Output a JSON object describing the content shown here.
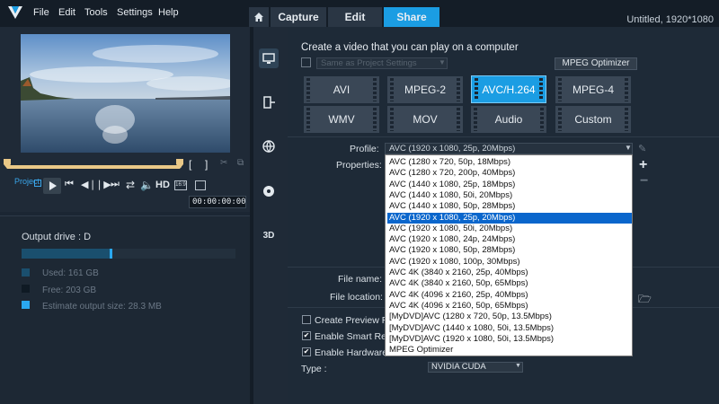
{
  "menu": {
    "items": [
      "File",
      "Edit",
      "Tools",
      "Settings",
      "Help"
    ]
  },
  "tabs": {
    "home_icon": "home-icon",
    "items": [
      "Capture",
      "Edit",
      "Share"
    ],
    "active": "Share"
  },
  "window": {
    "title": "Untitled, 1920*1080"
  },
  "player": {
    "project_label": "Project",
    "hd_label": "HD",
    "timecode": "00:00:00:00",
    "ratio_label": "16:9"
  },
  "output": {
    "drive_label": "Output drive : D",
    "used": "Used:  161 GB",
    "free": "Free:  203 GB",
    "estimate": "Estimate output size:  28.3 MB",
    "used_fraction": 0.41,
    "colors": {
      "used": "#1a4f6e",
      "free": "#0f1a24",
      "estimate": "#2aa8f0"
    }
  },
  "sidebar_icons": [
    "computer-icon",
    "device-icon",
    "web-icon",
    "disc-icon",
    "3d-icon"
  ],
  "share": {
    "heading": "Create a video that you can play on a computer",
    "same_as_project": "Same as Project Settings",
    "mpeg_optimizer_button": "MPEG Optimizer",
    "formats": [
      "AVI",
      "MPEG-2",
      "AVC/H.264",
      "MPEG-4",
      "WMV",
      "MOV",
      "Audio",
      "Custom"
    ],
    "active_format": "AVC/H.264",
    "profile_label": "Profile:",
    "profile_value": "AVC (1920 x 1080, 25p, 20Mbps)",
    "properties_label": "Properties:",
    "profile_options": [
      "AVC (1280 x 720, 50p, 18Mbps)",
      "AVC (1280 x 720, 200p, 40Mbps)",
      "AVC (1440 x 1080, 25p, 18Mbps)",
      "AVC (1440 x 1080, 50i, 20Mbps)",
      "AVC (1440 x 1080, 50p, 28Mbps)",
      "AVC (1920 x 1080, 25p, 20Mbps)",
      "AVC (1920 x 1080, 50i, 20Mbps)",
      "AVC (1920 x 1080, 24p, 24Mbps)",
      "AVC (1920 x 1080, 50p, 28Mbps)",
      "AVC (1920 x 1080, 100p, 30Mbps)",
      "AVC 4K (3840 x 2160, 25p, 40Mbps)",
      "AVC 4K (3840 x 2160, 50p, 65Mbps)",
      "AVC 4K (4096 x 2160, 25p, 40Mbps)",
      "AVC 4K (4096 x 2160, 50p, 65Mbps)",
      "[MyDVD]AVC (1280 x 720, 50p, 13.5Mbps)",
      "[MyDVD]AVC (1440 x 1080, 50i, 13.5Mbps)",
      "[MyDVD]AVC (1920 x 1080, 50i, 13.5Mbps)",
      "MPEG Optimizer"
    ],
    "selected_option_index": 5,
    "file_name_label": "File name:",
    "file_location_label": "File location:",
    "preview_range": "Create Preview Ran",
    "smart_render": "Enable Smart Rende",
    "hardware": "Enable Hardware e",
    "type_label": "Type :",
    "type_value": "NVIDIA CUDA"
  }
}
